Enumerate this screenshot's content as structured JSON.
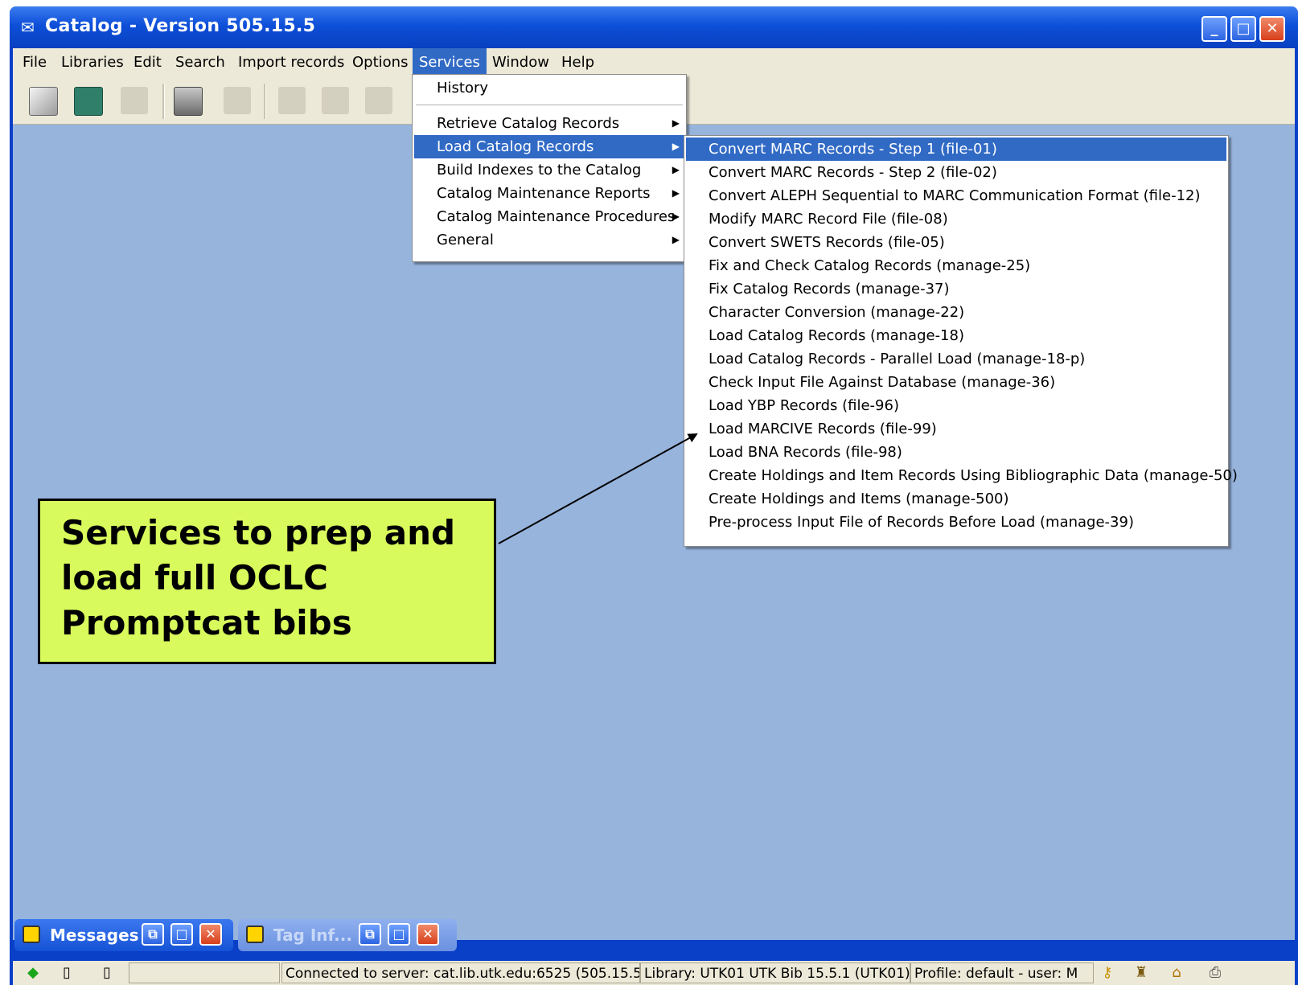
{
  "window": {
    "title": "Catalog - Version 505.15.5"
  },
  "menubar": {
    "items": [
      "File",
      "Libraries",
      "Edit",
      "Search",
      "Import records",
      "Options",
      "Services",
      "Window",
      "Help"
    ]
  },
  "services_menu": {
    "items": [
      "History",
      "Retrieve Catalog Records",
      "Load Catalog Records",
      "Build Indexes to the Catalog",
      "Catalog Maintenance Reports",
      "Catalog Maintenance Procedures",
      "General"
    ]
  },
  "load_submenu": {
    "items": [
      "Convert MARC Records - Step 1 (file-01)",
      "Convert MARC Records - Step 2 (file-02)",
      "Convert ALEPH Sequential to MARC Communication Format (file-12)",
      "Modify MARC Record File (file-08)",
      "Convert SWETS Records (file-05)",
      "Fix and Check Catalog Records (manage-25)",
      "Fix Catalog Records (manage-37)",
      "Character Conversion (manage-22)",
      "Load Catalog Records (manage-18)",
      "Load Catalog Records - Parallel Load (manage-18-p)",
      "Check Input File Against Database (manage-36)",
      "Load YBP Records (file-96)",
      "Load MARCIVE Records (file-99)",
      "Load BNA Records (file-98)",
      "Create Holdings and Item Records Using Bibliographic Data (manage-50)",
      "Create Holdings and Items (manage-500)",
      "Pre-process Input File of Records Before Load (manage-39)"
    ]
  },
  "callout": {
    "lines": [
      "Services to prep and",
      "load full OCLC",
      "Promptcat bibs"
    ]
  },
  "taskbar": {
    "messages_label": "Messages",
    "taginfo_label": "Tag Inf..."
  },
  "statusbar": {
    "connection": "Connected to server:  cat.lib.utk.edu:6525 (505.15.5",
    "library": "Library:  UTK01 UTK Bib 15.5.1 (UTK01)",
    "profile": "Profile: default - user:  M"
  }
}
